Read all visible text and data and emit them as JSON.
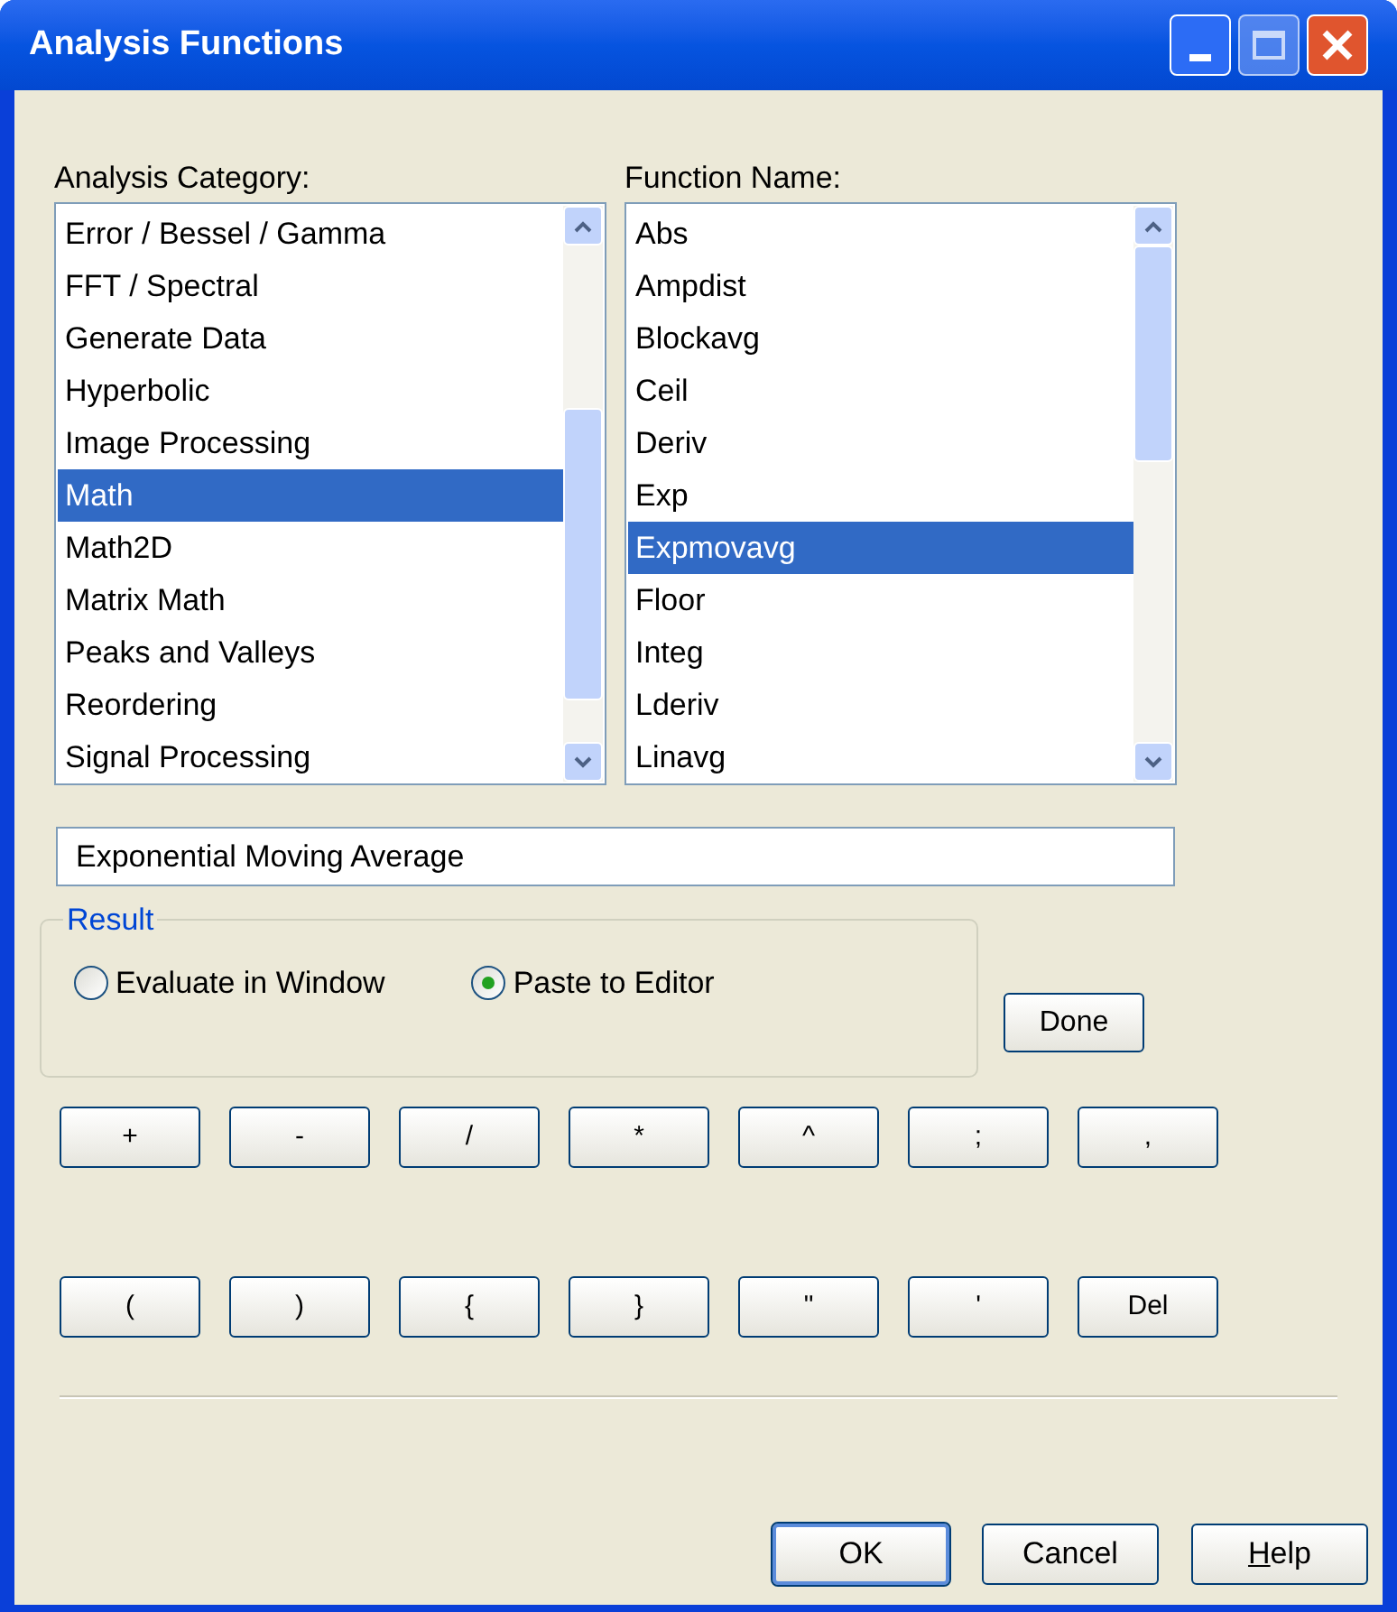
{
  "window": {
    "title": "Analysis Functions"
  },
  "category_list": {
    "label": "Analysis Category:",
    "items": [
      {
        "text": "Error / Bessel / Gamma",
        "selected": false
      },
      {
        "text": "FFT / Spectral",
        "selected": false
      },
      {
        "text": "Generate Data",
        "selected": false
      },
      {
        "text": "Hyperbolic",
        "selected": false
      },
      {
        "text": "Image Processing",
        "selected": false
      },
      {
        "text": "Math",
        "selected": true
      },
      {
        "text": "Math2D",
        "selected": false
      },
      {
        "text": "Matrix Math",
        "selected": false
      },
      {
        "text": "Peaks and Valleys",
        "selected": false
      },
      {
        "text": "Reordering",
        "selected": false
      },
      {
        "text": "Signal Processing",
        "selected": false
      }
    ]
  },
  "function_list": {
    "label": "Function Name:",
    "items": [
      {
        "text": "Abs",
        "selected": false
      },
      {
        "text": "Ampdist",
        "selected": false
      },
      {
        "text": "Blockavg",
        "selected": false
      },
      {
        "text": "Ceil",
        "selected": false
      },
      {
        "text": "Deriv",
        "selected": false
      },
      {
        "text": "Exp",
        "selected": false
      },
      {
        "text": "Expmovavg",
        "selected": true
      },
      {
        "text": "Floor",
        "selected": false
      },
      {
        "text": "Integ",
        "selected": false
      },
      {
        "text": "Lderiv",
        "selected": false
      },
      {
        "text": "Linavg",
        "selected": false
      }
    ]
  },
  "description": {
    "value": "Exponential Moving Average"
  },
  "result": {
    "label": "Result",
    "options": [
      {
        "label": "Evaluate in Window",
        "selected": false
      },
      {
        "label": "Paste to Editor",
        "selected": true
      }
    ]
  },
  "done_button": "Done",
  "operator_rows": [
    [
      "+",
      "-",
      "/",
      "*",
      "^",
      ";",
      ","
    ],
    [
      "(",
      ")",
      "{",
      "}",
      "\"",
      "'",
      "Del"
    ]
  ],
  "dialog_buttons": [
    {
      "label": "OK",
      "default": true,
      "underline_first_letter": false
    },
    {
      "label": "Cancel",
      "default": false,
      "underline_first_letter": false
    },
    {
      "label": "Help",
      "default": false,
      "underline_first_letter": true
    }
  ]
}
